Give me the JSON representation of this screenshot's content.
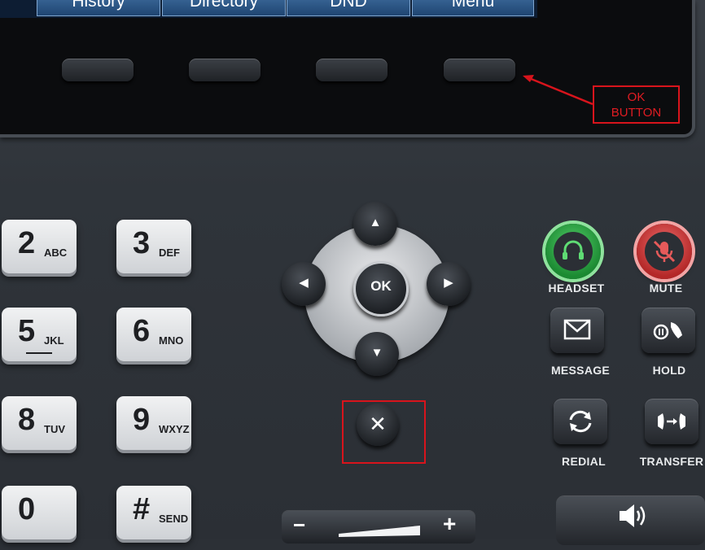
{
  "softkeys": [
    {
      "label": "History"
    },
    {
      "label": "Directory"
    },
    {
      "label": "DND"
    },
    {
      "label": "Menu"
    }
  ],
  "annotations": {
    "ok_button": "OK\nBUTTON",
    "accent": "#d8141c"
  },
  "keypad": [
    {
      "digit": "2",
      "letters": "ABC"
    },
    {
      "digit": "3",
      "letters": "DEF"
    },
    {
      "digit": "5",
      "letters": "JKL"
    },
    {
      "digit": "6",
      "letters": "MNO"
    },
    {
      "digit": "8",
      "letters": "TUV"
    },
    {
      "digit": "9",
      "letters": "WXYZ"
    },
    {
      "digit": "0",
      "letters": ""
    },
    {
      "digit": "#",
      "letters": "SEND"
    }
  ],
  "nav": {
    "ok_label": "OK",
    "up": "▲",
    "down": "▼",
    "left": "◀",
    "right": "▶",
    "cancel": "✕"
  },
  "function_keys": {
    "headset": {
      "label": "HEADSET",
      "icon": "headset-icon",
      "color": "#2fb24a"
    },
    "mute": {
      "label": "MUTE",
      "icon": "mute-microphone-icon",
      "color": "#d83a3a"
    },
    "message": {
      "label": "MESSAGE",
      "icon": "envelope-icon"
    },
    "hold": {
      "label": "HOLD",
      "icon": "hold-phone-icon"
    },
    "redial": {
      "label": "REDIAL",
      "icon": "redial-arrows-icon"
    },
    "transfer": {
      "label": "TRANSFER",
      "icon": "transfer-phone-icon"
    }
  },
  "volume": {
    "minus": "−",
    "plus": "+"
  },
  "speaker": {
    "icon": "speaker-icon"
  }
}
